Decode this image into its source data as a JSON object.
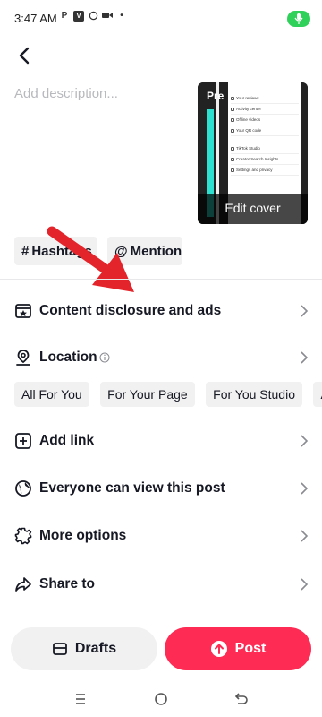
{
  "status_bar": {
    "time": "3:47 AM",
    "icons": [
      "P",
      "V",
      "whatsapp",
      "video",
      "dot"
    ]
  },
  "header": {
    "back_icon": "chevron-left-icon"
  },
  "description": {
    "placeholder": "Add description..."
  },
  "cover": {
    "label": "Edit cover",
    "preview_text": "Pre",
    "menu_items": [
      "Your reviews",
      "Activity center",
      "Offline videos",
      "Your QR code",
      "TikTok Studio",
      "Creator Search Insights",
      "Settings and privacy"
    ]
  },
  "chips": {
    "hashtags": "Hashtags",
    "mention": "Mention"
  },
  "rows": {
    "content_disclosure": "Content disclosure and ads",
    "location": "Location",
    "add_link": "Add link",
    "privacy": "Everyone can view this post",
    "more_options": "More options",
    "share_to": "Share to"
  },
  "location_suggestions": [
    "All For You",
    "For Your Page",
    "For You Studio",
    "All"
  ],
  "actions": {
    "drafts": "Drafts",
    "post": "Post"
  },
  "colors": {
    "accent": "#fe2c55",
    "arrow": "#e3242b",
    "mic": "#2fd15a"
  }
}
